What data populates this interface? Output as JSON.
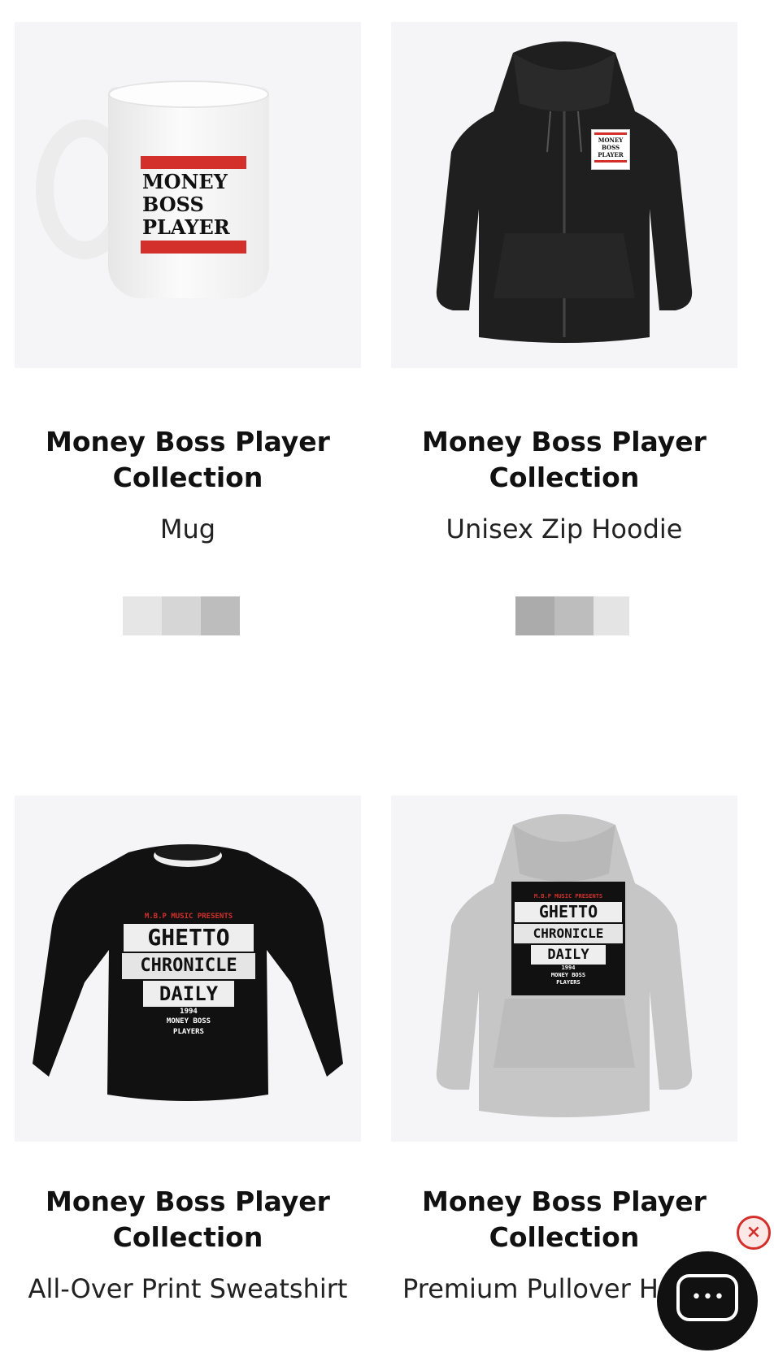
{
  "products": [
    {
      "title": "Money Boss Player Collection",
      "title_lines": [
        "Money Boss Player",
        "Collection"
      ],
      "product": "Mug",
      "image": {
        "type": "mug",
        "print_text": [
          "MONEY",
          "BOSS",
          "PLAYER"
        ]
      }
    },
    {
      "title": "Money Boss Player Collection",
      "title_lines": [
        "Money Boss Player",
        "Collection"
      ],
      "product": "Unisex Zip Hoodie",
      "image": {
        "type": "zip-hoodie",
        "color": "#1f1f1f",
        "print_text": [
          "MONEY",
          "BOSS",
          "PLAYER"
        ]
      }
    },
    {
      "title": "Money Boss Player Collection",
      "title_lines": [
        "Money Boss Player",
        "Collection"
      ],
      "product": "All-Over Print Sweatshirt",
      "image": {
        "type": "sweatshirt",
        "color": "#111111",
        "print_text": [
          "M.B.P MUSIC PRESENTS",
          "GHETTO",
          "CHRONICLE",
          "DAILY",
          "1994",
          "MONEY BOSS",
          "PLAYERS"
        ]
      }
    },
    {
      "title": "Money Boss Player Collection",
      "title_lines": [
        "Money Boss Player",
        "Collection"
      ],
      "product": "Premium Pullover Hoodie",
      "product_visible": "Premium Pullover H",
      "image": {
        "type": "pullover-hoodie",
        "color": "#c6c6c6",
        "print_text": [
          "M.B.P MUSIC PRESENTS",
          "GHETTO",
          "CHRONICLE",
          "DAILY",
          "1994",
          "MONEY BOSS",
          "PLAYERS"
        ]
      }
    }
  ],
  "chat_widget": {
    "close_icon": "close-icon",
    "bubble_icon": "chat-bubble-icon",
    "dots": "•••",
    "close_glyph": "×"
  },
  "colors": {
    "accent": "#d3302b",
    "thumb_bg": "#f5f5f7"
  }
}
